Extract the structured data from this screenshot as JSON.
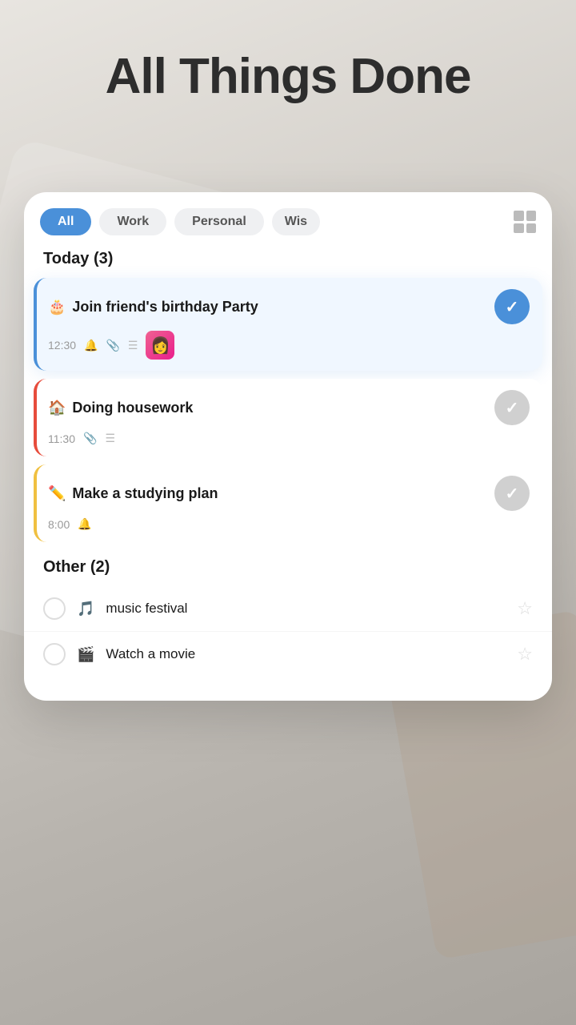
{
  "app": {
    "title": "All Things Done"
  },
  "filters": {
    "tabs": [
      {
        "label": "All",
        "active": true
      },
      {
        "label": "Work",
        "active": false
      },
      {
        "label": "Personal",
        "active": false
      },
      {
        "label": "Wis",
        "active": false,
        "truncated": true
      }
    ],
    "grid_icon": "grid-icon"
  },
  "today_section": {
    "title": "Today (3)",
    "tasks": [
      {
        "id": 1,
        "emoji": "🎂",
        "title": "Join friend's birthday Party",
        "time": "12:30",
        "has_bell": true,
        "has_attachment": true,
        "has_list": true,
        "has_thumb": true,
        "completed": true,
        "style": "highlighted"
      },
      {
        "id": 2,
        "emoji": "🏠",
        "title": "Doing housework",
        "time": "11:30",
        "has_bell": false,
        "has_attachment": true,
        "has_list": true,
        "has_thumb": false,
        "completed": false,
        "style": "red-border"
      },
      {
        "id": 3,
        "emoji": "✏️",
        "title": "Make a studying plan",
        "time": "8:00",
        "has_bell": true,
        "has_attachment": false,
        "has_list": false,
        "has_thumb": false,
        "completed": false,
        "style": "yellow-border"
      }
    ]
  },
  "other_section": {
    "title": "Other (2)",
    "tasks": [
      {
        "id": 4,
        "emoji": "🎵",
        "title": "music festival",
        "starred": false
      },
      {
        "id": 5,
        "emoji": "🎬",
        "title": "Watch a movie",
        "starred": false
      }
    ]
  }
}
